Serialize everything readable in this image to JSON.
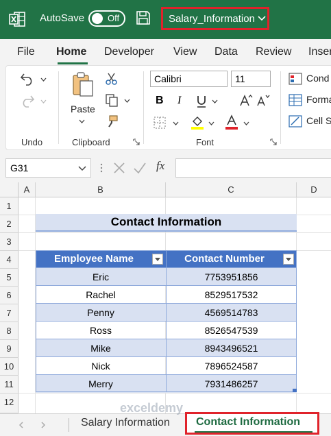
{
  "titlebar": {
    "autosave_label": "AutoSave",
    "autosave_state": "Off",
    "filename": "Salary_Information",
    "bg_color": "#217346",
    "highlight_color": "#e0232b"
  },
  "menu": {
    "items": [
      "File",
      "Home",
      "Developer",
      "View",
      "Data",
      "Review",
      "Inser"
    ],
    "active": "Home"
  },
  "ribbon": {
    "undo_group": "Undo",
    "clipboard_group": "Clipboard",
    "paste_label": "Paste",
    "font_group": "Font",
    "font_name": "Calibri",
    "font_size": "11",
    "bold": "B",
    "italic": "I",
    "styles": [
      "Cond",
      "Forma",
      "Cell S"
    ]
  },
  "formula_bar": {
    "name_box": "G31",
    "fx": "fx",
    "formula": ""
  },
  "grid": {
    "columns": [
      "A",
      "B",
      "C",
      "D"
    ],
    "rows": [
      "1",
      "2",
      "3",
      "4",
      "5",
      "6",
      "7",
      "8",
      "9",
      "10",
      "11",
      "12"
    ],
    "title": "Contact Information",
    "table": {
      "headers": [
        "Employee Name",
        "Contact Number"
      ],
      "rows": [
        [
          "Eric",
          "7753951856"
        ],
        [
          "Rachel",
          "8529517532"
        ],
        [
          "Penny",
          "4569514783"
        ],
        [
          "Ross",
          "8526547539"
        ],
        [
          "Mike",
          "8943496521"
        ],
        [
          "Nick",
          "7896524587"
        ],
        [
          "Merry",
          "7931486257"
        ]
      ],
      "header_color": "#4472c4",
      "band_color": "#d9e1f2"
    }
  },
  "sheets": {
    "tabs": [
      "Salary Information",
      "Contact Information"
    ],
    "active": "Contact Information"
  },
  "watermark": "exceldemy"
}
